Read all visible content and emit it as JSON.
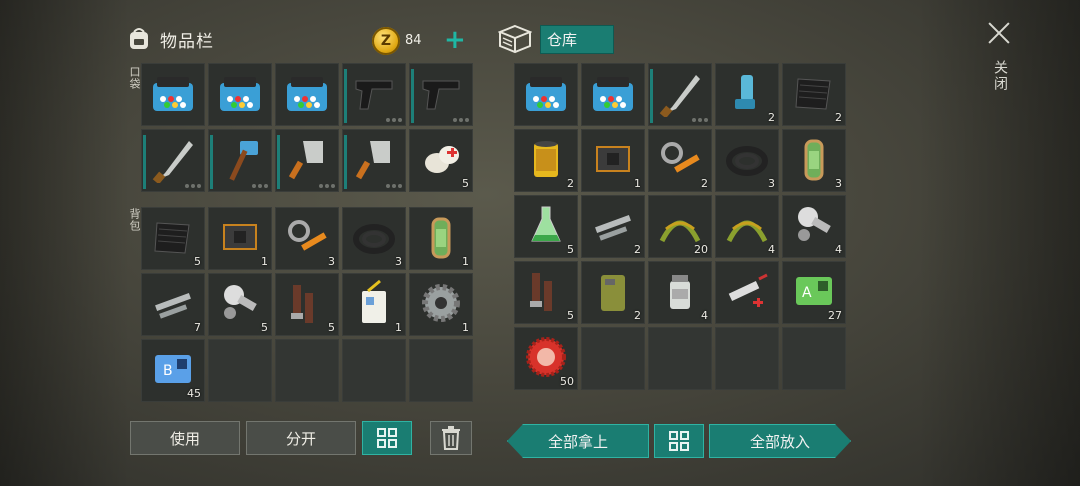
{
  "inventory": {
    "title": "物品栏",
    "coins": "84",
    "coin_symbol": "Z",
    "pocket_label": "口袋",
    "backpack_label": "背包",
    "pocket": [
      {
        "icon": "medkit-box-icon",
        "count": ""
      },
      {
        "icon": "medkit-box-icon",
        "count": ""
      },
      {
        "icon": "medkit-box-icon",
        "count": ""
      },
      {
        "icon": "pistol-icon",
        "count": ""
      },
      {
        "icon": "pistol-icon",
        "count": ""
      },
      {
        "icon": "machete-icon",
        "count": ""
      },
      {
        "icon": "sledgehammer-icon",
        "count": ""
      },
      {
        "icon": "cleaver-icon",
        "count": ""
      },
      {
        "icon": "cleaver-icon",
        "count": ""
      },
      {
        "icon": "bandage-icon",
        "count": "5"
      }
    ],
    "backpack": [
      {
        "icon": "rubber-sheet-icon",
        "count": "5"
      },
      {
        "icon": "circuit-board-icon",
        "count": "1"
      },
      {
        "icon": "hydraulic-parts-icon",
        "count": "3"
      },
      {
        "icon": "rubber-hose-icon",
        "count": "3"
      },
      {
        "icon": "fuel-canister-icon",
        "count": "1"
      },
      {
        "icon": "metal-pipes-icon",
        "count": "7"
      },
      {
        "icon": "engine-parts-icon",
        "count": "5"
      },
      {
        "icon": "pipe-fittings-icon",
        "count": "5"
      },
      {
        "icon": "id-badge-icon",
        "count": "1"
      },
      {
        "icon": "gear-icon",
        "count": "1"
      },
      {
        "icon": "keycard-b-icon",
        "count": "45"
      },
      {
        "icon": "",
        "count": ""
      },
      {
        "icon": "",
        "count": ""
      },
      {
        "icon": "",
        "count": ""
      },
      {
        "icon": "",
        "count": ""
      }
    ]
  },
  "warehouse": {
    "title": "仓库",
    "items": [
      {
        "icon": "medkit-box-icon",
        "count": ""
      },
      {
        "icon": "medkit-box-icon",
        "count": ""
      },
      {
        "icon": "machete-icon",
        "count": ""
      },
      {
        "icon": "inhaler-icon",
        "count": "2"
      },
      {
        "icon": "rubber-sheet-icon",
        "count": "2"
      },
      {
        "icon": "oil-filter-icon",
        "count": "2"
      },
      {
        "icon": "circuit-board-icon",
        "count": "1"
      },
      {
        "icon": "hydraulic-parts-icon",
        "count": "2"
      },
      {
        "icon": "rubber-hose-icon",
        "count": "3"
      },
      {
        "icon": "fuel-canister-icon",
        "count": "3"
      },
      {
        "icon": "chemical-flask-icon",
        "count": "5"
      },
      {
        "icon": "metal-pipes-icon",
        "count": "2"
      },
      {
        "icon": "herb-icon",
        "count": "20"
      },
      {
        "icon": "herb-icon",
        "count": "4"
      },
      {
        "icon": "engine-parts-icon",
        "count": "4"
      },
      {
        "icon": "pipe-fittings-icon",
        "count": "5"
      },
      {
        "icon": "jerrycan-icon",
        "count": "2"
      },
      {
        "icon": "medicine-jar-icon",
        "count": "4"
      },
      {
        "icon": "syringe-icon",
        "count": ""
      },
      {
        "icon": "keycard-a-icon",
        "count": "27"
      },
      {
        "icon": "bottle-cap-icon",
        "count": "50"
      },
      {
        "icon": "",
        "count": ""
      },
      {
        "icon": "",
        "count": ""
      },
      {
        "icon": "",
        "count": ""
      },
      {
        "icon": "",
        "count": ""
      }
    ]
  },
  "buttons": {
    "use": "使用",
    "split": "分开",
    "take_all": "全部拿上",
    "put_all": "全部放入",
    "close": "关闭"
  },
  "colors": {
    "accent": "#1a7d72",
    "accent_light": "#2fb3a3",
    "coin": "#e0a812"
  }
}
